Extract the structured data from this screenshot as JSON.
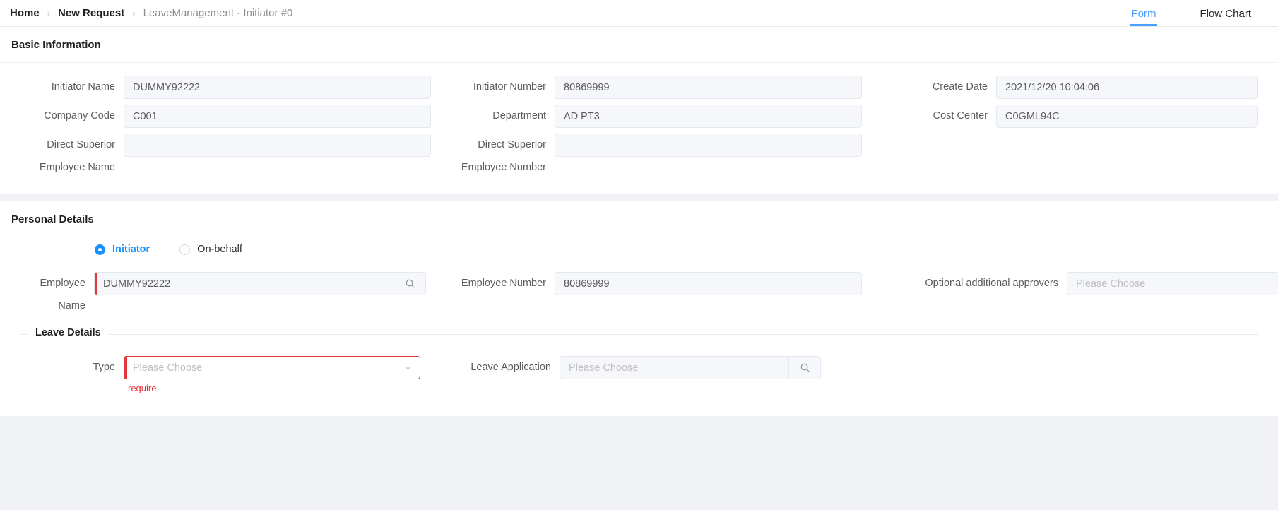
{
  "header": {
    "breadcrumb": [
      {
        "label": "Home",
        "current": false
      },
      {
        "label": "New Request",
        "current": false
      },
      {
        "label": "LeaveManagement - Initiator #0",
        "current": true
      }
    ],
    "separator": "›",
    "tabs": [
      {
        "label": "Form",
        "active": true
      },
      {
        "label": "Flow Chart",
        "active": false
      }
    ],
    "accent_color": "#4a9eff"
  },
  "basic_information": {
    "title": "Basic Information",
    "fields": {
      "initiator_name": {
        "label": "Initiator Name",
        "value": "DUMMY92222"
      },
      "initiator_number": {
        "label": "Initiator Number",
        "value": "80869999"
      },
      "create_date": {
        "label": "Create Date",
        "value": "2021/12/20 10:04:06"
      },
      "company_code": {
        "label": "Company Code",
        "value": "C001"
      },
      "department": {
        "label": "Department",
        "value": "AD PT3"
      },
      "cost_center": {
        "label": "Cost Center",
        "value": "C0GML94C"
      },
      "direct_superior_employee_name": {
        "label": "Direct Superior\nEmployee Name",
        "value": ""
      },
      "direct_superior_employee_number": {
        "label": "Direct Superior\nEmployee Number",
        "value": ""
      }
    }
  },
  "personal_details": {
    "title": "Personal Details",
    "radio_group": {
      "options": [
        {
          "label": "Initiator",
          "selected": true
        },
        {
          "label": "On-behalf",
          "selected": false
        }
      ],
      "selected_color": "#1890ff"
    },
    "fields": {
      "employee_name": {
        "label": "Employee\nName",
        "value": "DUMMY92222",
        "placeholder": "",
        "icon": "search-icon",
        "required_marker_color": "#e4393c"
      },
      "employee_number": {
        "label": "Employee Number",
        "value": "80869999"
      },
      "optional_additional_approvers": {
        "label": "Optional additional approvers",
        "value": "",
        "placeholder": "Please Choose",
        "icon": "search-icon"
      }
    },
    "leave_details": {
      "title": "Leave Details",
      "fields": {
        "type": {
          "label": "Type",
          "value": "",
          "placeholder": "Please Choose",
          "icon": "chevron-down-icon",
          "error": "require",
          "error_color": "#e4393c"
        },
        "leave_application": {
          "label": "Leave Application",
          "value": "",
          "placeholder": "Please Choose",
          "icon": "search-icon"
        }
      }
    }
  }
}
